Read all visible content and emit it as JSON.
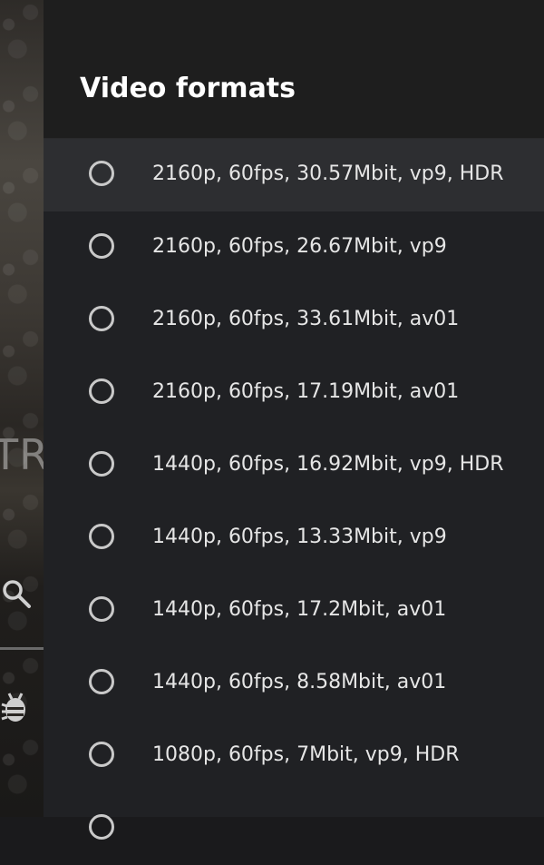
{
  "background": {
    "partial_text": "TR",
    "icons": [
      "search-icon",
      "bug-icon"
    ]
  },
  "dialog": {
    "title": "Video formats",
    "options": [
      {
        "label": "2160p, 60fps, 30.57Mbit, vp9, HDR",
        "selected": false,
        "focused": true
      },
      {
        "label": "2160p, 60fps, 26.67Mbit, vp9",
        "selected": false
      },
      {
        "label": "2160p, 60fps, 33.61Mbit, av01",
        "selected": false
      },
      {
        "label": "2160p, 60fps, 17.19Mbit, av01",
        "selected": false
      },
      {
        "label": "1440p, 60fps, 16.92Mbit, vp9, HDR",
        "selected": false
      },
      {
        "label": "1440p, 60fps, 13.33Mbit, vp9",
        "selected": false
      },
      {
        "label": "1440p, 60fps, 17.2Mbit, av01",
        "selected": false
      },
      {
        "label": "1440p, 60fps, 8.58Mbit, av01",
        "selected": false
      },
      {
        "label": "1080p, 60fps, 7Mbit, vp9, HDR",
        "selected": false
      },
      {
        "label": "",
        "selected": false
      }
    ]
  },
  "colors": {
    "dialog_bg": "#202124",
    "header_bg": "#1e1e1e",
    "focused_row": "#2d2e31",
    "text": "#e6e6e6",
    "radio": "#c9c9c9"
  }
}
